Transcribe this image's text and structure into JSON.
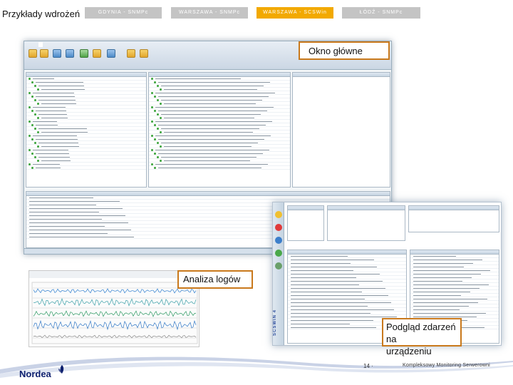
{
  "slide": {
    "title": "Przykłady wdrożeń"
  },
  "tabs": [
    {
      "label": "GDYNIA - SNMPc",
      "active": false
    },
    {
      "label": "WARSZAWA - SNMPc",
      "active": false
    },
    {
      "label": "WARSZAWA - SCSWin",
      "active": true
    },
    {
      "label": "ŁÓDŹ - SNMPc",
      "active": false
    }
  ],
  "callouts": {
    "main_window": "Okno główne",
    "log_analysis": "Analiza logów",
    "device_events_line1": "Podgląd zdarzeń na",
    "device_events_line2": "urządzeniu"
  },
  "screenshots": {
    "device_side_label": "SCSWIN 4"
  },
  "footer": {
    "brand": "Nordea",
    "page_number": "14 ·",
    "caption": "Kompleksowy Monitoring Serwerowni"
  },
  "colors": {
    "active_tab": "#f2a900",
    "inactive_tab": "#c4c4c4",
    "callout_border": "#c9791c",
    "brand_blue": "#0d1f6e"
  }
}
